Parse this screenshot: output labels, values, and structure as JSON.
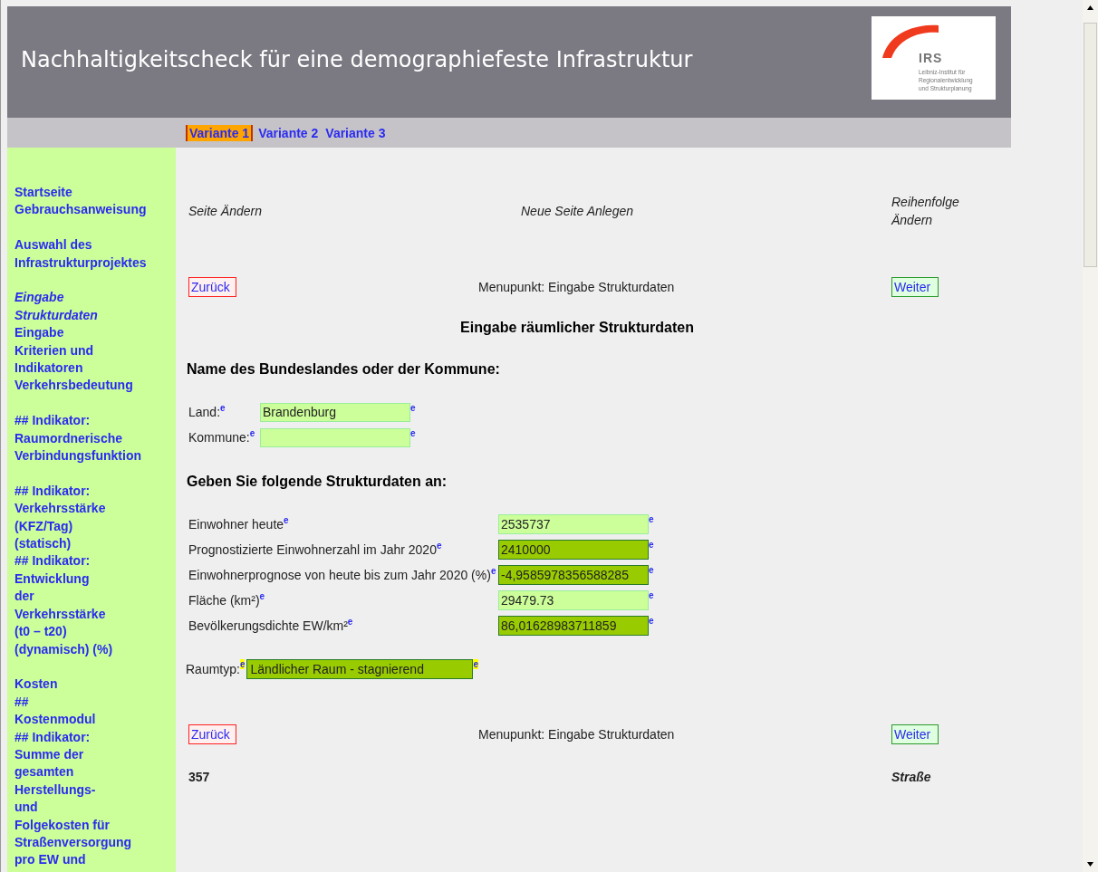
{
  "header": {
    "title": "Nachhaltigkeitscheck für eine demographiefeste Infrastruktur",
    "logo": {
      "name": "IRS",
      "lines": [
        "Leibniz-Institut für",
        "Regionalentwicklung",
        "und Strukturplanung"
      ]
    }
  },
  "variants": [
    {
      "label": "Variante 1",
      "selected": true
    },
    {
      "label": "Variante 2",
      "selected": false
    },
    {
      "label": "Variante 3",
      "selected": false
    }
  ],
  "sidebar": {
    "groups": [
      [
        {
          "lines": [
            "Startseite"
          ],
          "selected": false
        },
        {
          "lines": [
            "Gebrauchsanweisung"
          ],
          "selected": false
        }
      ],
      [
        {
          "lines": [
            "Auswahl des",
            "Infrastrukturprojektes"
          ],
          "selected": false
        }
      ],
      [
        {
          "lines": [
            "Eingabe",
            "Strukturdaten"
          ],
          "selected": true
        },
        {
          "lines": [
            "Eingabe",
            "Kriterien und",
            "Indikatoren"
          ],
          "selected": false
        },
        {
          "lines": [
            "Verkehrsbedeutung"
          ],
          "selected": false
        }
      ],
      [
        {
          "lines": [
            "## Indikator:",
            "Raumordnerische",
            "Verbindungsfunktion"
          ],
          "selected": false
        }
      ],
      [
        {
          "lines": [
            "## Indikator:",
            "Verkehrsstärke",
            "(KFZ/Tag)",
            "(statisch)"
          ],
          "selected": false
        },
        {
          "lines": [
            "## Indikator:",
            "Entwicklung",
            "der",
            "Verkehrsstärke",
            "(t0 – t20)",
            "(dynamisch) (%)"
          ],
          "selected": false
        }
      ],
      [
        {
          "lines": [
            "Kosten"
          ],
          "selected": false
        },
        {
          "lines": [
            "##",
            "Kostenmodul"
          ],
          "selected": false
        },
        {
          "lines": [
            "## Indikator:",
            "Summe der",
            "gesamten",
            "Herstellungs-",
            "und",
            "Folgekosten für",
            "Straßenversorgung",
            "pro EW und"
          ],
          "selected": false
        }
      ]
    ]
  },
  "page_actions": [
    "Seite Ändern",
    "Neue Seite Anlegen",
    "Reihenfolge Ändern"
  ],
  "nav_top": {
    "back": "Zurück",
    "menu_item": "Menupunkt: Eingabe Strukturdaten",
    "next": "Weiter"
  },
  "page_title": "Eingabe räumlicher Strukturdaten",
  "location_section": {
    "heading": "Name des Bundeslandes oder der Kommune:",
    "fields": [
      {
        "label": "Land:",
        "label_note": "e",
        "value": "Brandenburg",
        "value_note": "e"
      },
      {
        "label": "Kommune:",
        "label_note": "e",
        "value_note": "e"
      }
    ]
  },
  "structure_section": {
    "heading": "Geben Sie folgende Strukturdaten an:",
    "fields": [
      {
        "kind": "input",
        "label": "Einwohner heute",
        "label_note": "e",
        "value": "2535737",
        "value_note": "e"
      },
      {
        "kind": "computed",
        "label": "Prognostizierte Einwohnerzahl im Jahr 2020",
        "label_note": "e",
        "value": "2410000",
        "value_note": "e"
      },
      {
        "kind": "computed",
        "label": "Einwohnerprognose von heute bis zum Jahr 2020 (%)",
        "label_note": "e",
        "value": "-4,9585978356588285",
        "value_note": "e"
      },
      {
        "kind": "input",
        "label": "Fläche (km²)",
        "label_note": "e",
        "value": "29479.73",
        "value_note": "e"
      },
      {
        "kind": "computed",
        "label": "Bevölkerungsdichte EW/km²",
        "label_note": "e",
        "value": "86,01628983711859",
        "value_note": "e"
      }
    ]
  },
  "area_type": {
    "label": "Raumtyp:",
    "label_note": "e",
    "value": "Ländlicher Raum - stagnierend",
    "value_note": "e"
  },
  "nav_bottom": {
    "back": "Zurück",
    "menu_item": "Menupunkt: Eingabe Strukturdaten",
    "next": "Weiter"
  },
  "footer": {
    "number": "357",
    "category": "Straße"
  }
}
